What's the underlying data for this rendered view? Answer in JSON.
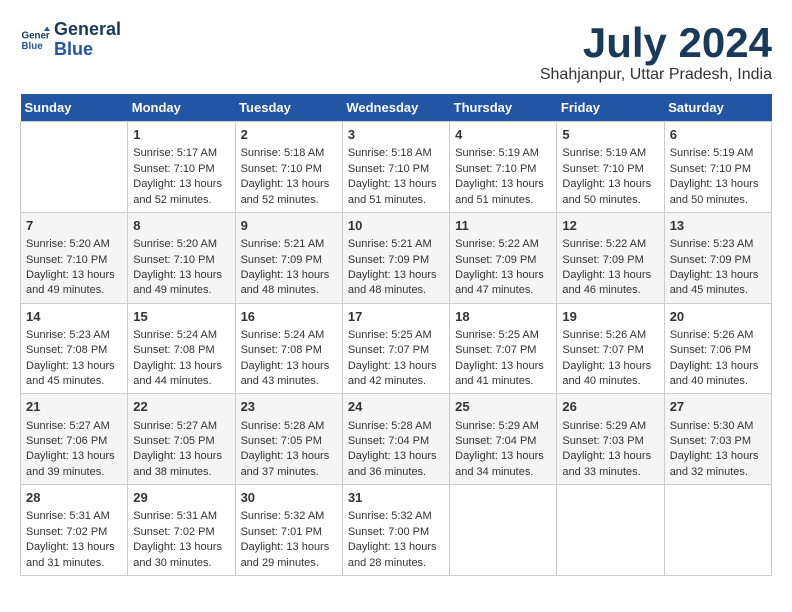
{
  "header": {
    "logo_line1": "General",
    "logo_line2": "Blue",
    "month_year": "July 2024",
    "location": "Shahjanpur, Uttar Pradesh, India"
  },
  "days_of_week": [
    "Sunday",
    "Monday",
    "Tuesday",
    "Wednesday",
    "Thursday",
    "Friday",
    "Saturday"
  ],
  "weeks": [
    [
      {
        "day": "",
        "content": ""
      },
      {
        "day": "1",
        "content": "Sunrise: 5:17 AM\nSunset: 7:10 PM\nDaylight: 13 hours\nand 52 minutes."
      },
      {
        "day": "2",
        "content": "Sunrise: 5:18 AM\nSunset: 7:10 PM\nDaylight: 13 hours\nand 52 minutes."
      },
      {
        "day": "3",
        "content": "Sunrise: 5:18 AM\nSunset: 7:10 PM\nDaylight: 13 hours\nand 51 minutes."
      },
      {
        "day": "4",
        "content": "Sunrise: 5:19 AM\nSunset: 7:10 PM\nDaylight: 13 hours\nand 51 minutes."
      },
      {
        "day": "5",
        "content": "Sunrise: 5:19 AM\nSunset: 7:10 PM\nDaylight: 13 hours\nand 50 minutes."
      },
      {
        "day": "6",
        "content": "Sunrise: 5:19 AM\nSunset: 7:10 PM\nDaylight: 13 hours\nand 50 minutes."
      }
    ],
    [
      {
        "day": "7",
        "content": "Sunrise: 5:20 AM\nSunset: 7:10 PM\nDaylight: 13 hours\nand 49 minutes."
      },
      {
        "day": "8",
        "content": "Sunrise: 5:20 AM\nSunset: 7:10 PM\nDaylight: 13 hours\nand 49 minutes."
      },
      {
        "day": "9",
        "content": "Sunrise: 5:21 AM\nSunset: 7:09 PM\nDaylight: 13 hours\nand 48 minutes."
      },
      {
        "day": "10",
        "content": "Sunrise: 5:21 AM\nSunset: 7:09 PM\nDaylight: 13 hours\nand 48 minutes."
      },
      {
        "day": "11",
        "content": "Sunrise: 5:22 AM\nSunset: 7:09 PM\nDaylight: 13 hours\nand 47 minutes."
      },
      {
        "day": "12",
        "content": "Sunrise: 5:22 AM\nSunset: 7:09 PM\nDaylight: 13 hours\nand 46 minutes."
      },
      {
        "day": "13",
        "content": "Sunrise: 5:23 AM\nSunset: 7:09 PM\nDaylight: 13 hours\nand 45 minutes."
      }
    ],
    [
      {
        "day": "14",
        "content": "Sunrise: 5:23 AM\nSunset: 7:08 PM\nDaylight: 13 hours\nand 45 minutes."
      },
      {
        "day": "15",
        "content": "Sunrise: 5:24 AM\nSunset: 7:08 PM\nDaylight: 13 hours\nand 44 minutes."
      },
      {
        "day": "16",
        "content": "Sunrise: 5:24 AM\nSunset: 7:08 PM\nDaylight: 13 hours\nand 43 minutes."
      },
      {
        "day": "17",
        "content": "Sunrise: 5:25 AM\nSunset: 7:07 PM\nDaylight: 13 hours\nand 42 minutes."
      },
      {
        "day": "18",
        "content": "Sunrise: 5:25 AM\nSunset: 7:07 PM\nDaylight: 13 hours\nand 41 minutes."
      },
      {
        "day": "19",
        "content": "Sunrise: 5:26 AM\nSunset: 7:07 PM\nDaylight: 13 hours\nand 40 minutes."
      },
      {
        "day": "20",
        "content": "Sunrise: 5:26 AM\nSunset: 7:06 PM\nDaylight: 13 hours\nand 40 minutes."
      }
    ],
    [
      {
        "day": "21",
        "content": "Sunrise: 5:27 AM\nSunset: 7:06 PM\nDaylight: 13 hours\nand 39 minutes."
      },
      {
        "day": "22",
        "content": "Sunrise: 5:27 AM\nSunset: 7:05 PM\nDaylight: 13 hours\nand 38 minutes."
      },
      {
        "day": "23",
        "content": "Sunrise: 5:28 AM\nSunset: 7:05 PM\nDaylight: 13 hours\nand 37 minutes."
      },
      {
        "day": "24",
        "content": "Sunrise: 5:28 AM\nSunset: 7:04 PM\nDaylight: 13 hours\nand 36 minutes."
      },
      {
        "day": "25",
        "content": "Sunrise: 5:29 AM\nSunset: 7:04 PM\nDaylight: 13 hours\nand 34 minutes."
      },
      {
        "day": "26",
        "content": "Sunrise: 5:29 AM\nSunset: 7:03 PM\nDaylight: 13 hours\nand 33 minutes."
      },
      {
        "day": "27",
        "content": "Sunrise: 5:30 AM\nSunset: 7:03 PM\nDaylight: 13 hours\nand 32 minutes."
      }
    ],
    [
      {
        "day": "28",
        "content": "Sunrise: 5:31 AM\nSunset: 7:02 PM\nDaylight: 13 hours\nand 31 minutes."
      },
      {
        "day": "29",
        "content": "Sunrise: 5:31 AM\nSunset: 7:02 PM\nDaylight: 13 hours\nand 30 minutes."
      },
      {
        "day": "30",
        "content": "Sunrise: 5:32 AM\nSunset: 7:01 PM\nDaylight: 13 hours\nand 29 minutes."
      },
      {
        "day": "31",
        "content": "Sunrise: 5:32 AM\nSunset: 7:00 PM\nDaylight: 13 hours\nand 28 minutes."
      },
      {
        "day": "",
        "content": ""
      },
      {
        "day": "",
        "content": ""
      },
      {
        "day": "",
        "content": ""
      }
    ]
  ]
}
